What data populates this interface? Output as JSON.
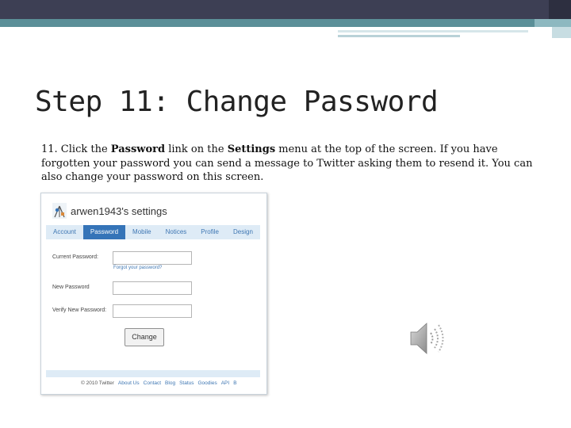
{
  "slide": {
    "title": "Step 11: Change Password",
    "body": {
      "prefix": "11. Click the ",
      "bold1": "Password",
      "middle": " link on the ",
      "bold2": "Settings",
      "suffix": " menu at the top of the screen. If you have forgotten your password you can send a message to Twitter asking them to resend it. You can also change your password on this screen."
    }
  },
  "twitter": {
    "header_title": "arwen1943's settings",
    "tabs": [
      {
        "label": "Account",
        "active": false
      },
      {
        "label": "Password",
        "active": true
      },
      {
        "label": "Mobile",
        "active": false
      },
      {
        "label": "Notices",
        "active": false
      },
      {
        "label": "Profile",
        "active": false
      },
      {
        "label": "Design",
        "active": false
      }
    ],
    "form": {
      "current_label": "Current Password:",
      "forgot_link": "Forgot your password?",
      "new_label": "New Password",
      "verify_label": "Verify New Password:",
      "change_button": "Change"
    },
    "footer": {
      "copyright": "© 2010 Twitter",
      "links": [
        "About Us",
        "Contact",
        "Blog",
        "Status",
        "Goodies",
        "API",
        "B"
      ]
    }
  },
  "icons": {
    "speaker": "speaker-icon",
    "avatar": "avatar-icon"
  },
  "colors": {
    "tab_active": "#3574b8",
    "tab_bar": "#deebf6",
    "link": "#3f77b3",
    "topbar": "#3d3f54",
    "teal": "#5b8f98"
  }
}
